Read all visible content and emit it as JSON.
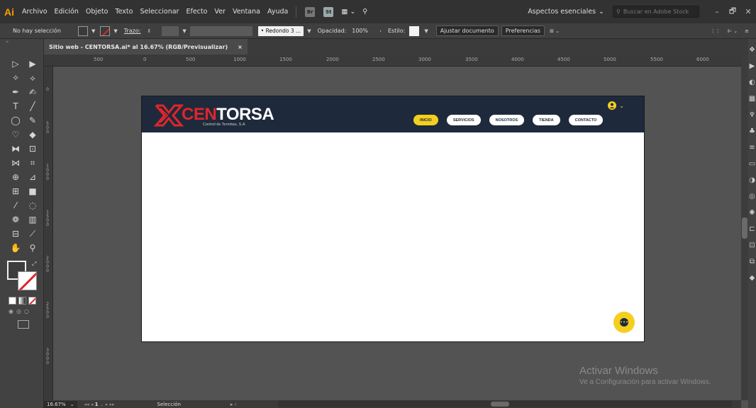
{
  "app": {
    "logo_text": "Ai",
    "menu": [
      "Archivo",
      "Edición",
      "Objeto",
      "Texto",
      "Seleccionar",
      "Efecto",
      "Ver",
      "Ventana",
      "Ayuda"
    ],
    "bridge_label": "Br",
    "stock_label": "St",
    "workspace_label": "Aspectos esenciales",
    "search_placeholder": "Buscar en Adobe Stock",
    "window_buttons": [
      "–",
      "🗗",
      "✕"
    ]
  },
  "control_bar": {
    "selection_status": "No hay selección",
    "stroke_label": "Trazo:",
    "brush_label": "Redondo 3 ...",
    "opacity_label": "Opacidad:",
    "opacity_value": "100%",
    "style_label": "Estilo:",
    "adjust_doc_button": "Ajustar documento",
    "preferences_button": "Preferencias"
  },
  "document": {
    "tab_title": "Sitio web - CENTORSA.ai* al 16.67% (RGB/Previsualizar)",
    "close_symbol": "×"
  },
  "rulers": {
    "horizontal": [
      "500",
      "0",
      "500",
      "1000",
      "1500",
      "2000",
      "2500",
      "3000",
      "3500",
      "4000",
      "4500",
      "5000",
      "5500",
      "6000"
    ],
    "vertical": [
      "0",
      "500",
      "1000",
      "1500",
      "2000",
      "2500",
      "3000"
    ]
  },
  "artboard": {
    "brand_part1": "CEN",
    "brand_part2": "TORSA",
    "brand_tagline": "Control de Termitas, S.A",
    "nav": [
      "INICIO",
      "SERVICIOS",
      "NOSOTROS",
      "TIENDA",
      "CONTACTO"
    ],
    "active_nav": "INICIO",
    "colors": {
      "header_bg": "#1e2a3b",
      "accent_yellow": "#f5cf1f",
      "brand_red": "#e0252b"
    },
    "chat_icon": "chat-bubble-icon"
  },
  "watermark": {
    "title": "Activar Windows",
    "subtitle": "Ve a Configuración para activar Windows."
  },
  "status_bar": {
    "zoom": "16.67%",
    "artboard_number": "1",
    "current_tool": "Selección"
  }
}
